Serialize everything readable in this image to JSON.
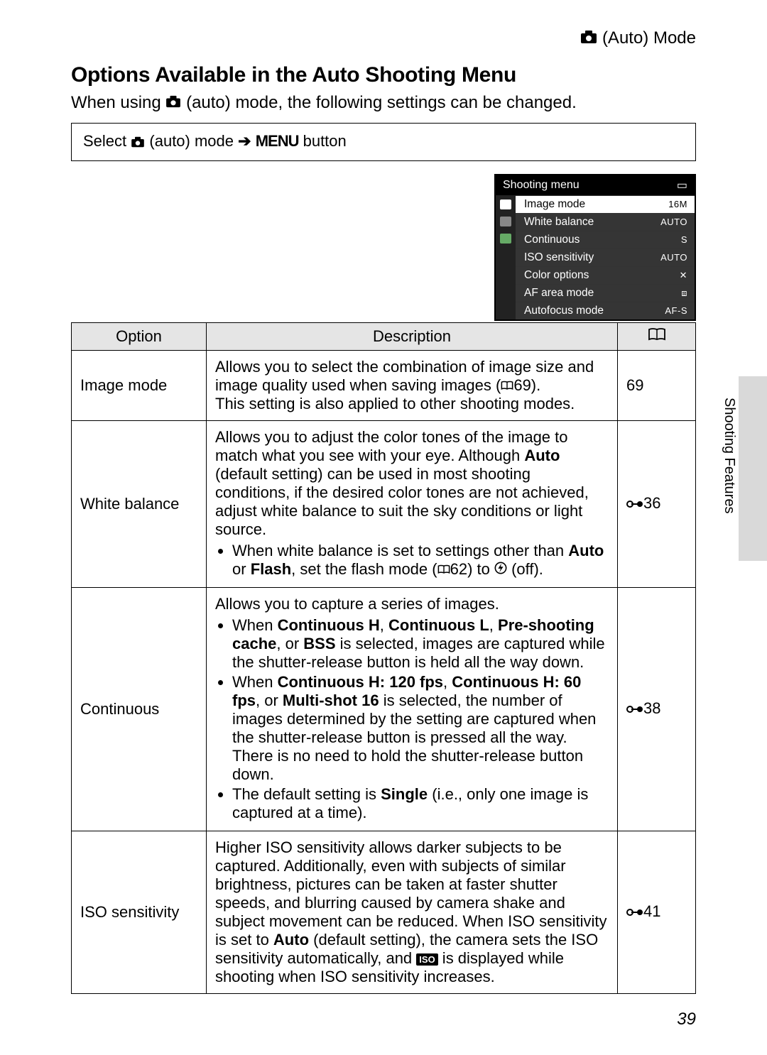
{
  "mode_label": "(Auto) Mode",
  "heading": "Options Available in the Auto Shooting Menu",
  "intro_pre": "When using ",
  "intro_post": " (auto) mode, the following settings can be changed.",
  "select_box_pre": "Select ",
  "select_box_mid": " (auto) mode ",
  "select_box_menu": "MENU",
  "select_box_post": " button",
  "menu_screen": {
    "title": "Shooting menu",
    "rows": [
      {
        "label": "Image mode",
        "value": "16M",
        "selected": true
      },
      {
        "label": "White balance",
        "value": "AUTO"
      },
      {
        "label": "Continuous",
        "value": "S"
      },
      {
        "label": "ISO sensitivity",
        "value": "AUTO"
      },
      {
        "label": "Color options",
        "value": "✕"
      },
      {
        "label": "AF area mode",
        "value": "⧈"
      },
      {
        "label": "Autofocus mode",
        "value": "AF-S"
      }
    ]
  },
  "table": {
    "head_option": "Option",
    "head_desc": "Description",
    "rows": [
      {
        "option": "Image mode",
        "ref": "69",
        "ref_type": "page"
      },
      {
        "option": "White balance",
        "ref": "36",
        "ref_type": "ext"
      },
      {
        "option": "Continuous",
        "ref": "38",
        "ref_type": "ext"
      },
      {
        "option": "ISO sensitivity",
        "ref": "41",
        "ref_type": "ext"
      }
    ]
  },
  "desc_strings": {
    "img_a": "Allows you to select the combination of image size and image quality used when saving images (",
    "img_b": "69).",
    "img_c": "This setting is also applied to other shooting modes.",
    "wb_a": "Allows you to adjust the color tones of the image to match what you see with your eye. Although ",
    "wb_auto": "Auto",
    "wb_b": " (default setting) can be used in most shooting conditions, if the desired color tones are not achieved, adjust white balance to suit the sky conditions or light source.",
    "wb_li_a": "When white balance is set to settings other than ",
    "wb_li_or": " or ",
    "wb_flash": "Flash",
    "wb_li_b": ", set the flash mode (",
    "wb_li_c": "62) to ",
    "wb_li_d": " (off).",
    "co_intro": "Allows you to capture a series of images.",
    "co_li1_a": "When ",
    "co_ch": "Continuous H",
    "co_cl": "Continuous L",
    "co_ps": "Pre-shooting cache",
    "co_bss": "BSS",
    "co_li1_b": " is selected, images are captured while the shutter-release button is held all the way down.",
    "co_li2_a": "When ",
    "co_120": "Continuous H: 120 fps",
    "co_60": "Continuous H: 60 fps",
    "co_m16": "Multi-shot 16",
    "co_li2_b": " is selected, the number of images determined by the setting are captured when the shutter-release button is pressed all the way. There is no need to hold the shutter-release button down.",
    "co_li3_a": "The default setting is ",
    "co_single": "Single",
    "co_li3_b": " (i.e., only one image is captured at a time).",
    "iso_a": "Higher ISO sensitivity allows darker subjects to be captured. Additionally, even with subjects of similar brightness, pictures can be taken at faster shutter speeds, and blurring caused by camera shake and subject movement can be reduced. When ISO sensitivity is set to ",
    "iso_auto": "Auto",
    "iso_b": " (default setting), the camera sets the ISO sensitivity automatically, and ",
    "iso_c": " is displayed while shooting when ISO sensitivity increases.",
    "comma_sp": ", ",
    "or_sp": ", or "
  },
  "side_label": "Shooting Features",
  "page_number": "39",
  "arrow": "➔"
}
